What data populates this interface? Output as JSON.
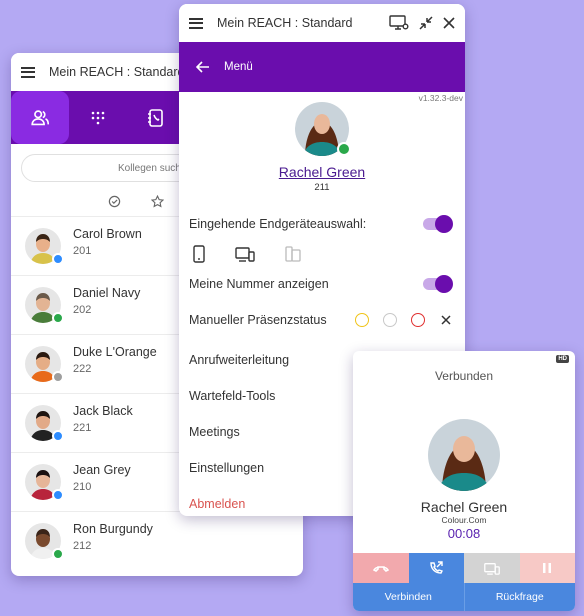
{
  "back_window": {
    "title": "Mein REACH : Standard",
    "search_placeholder": "Kollegen suche",
    "contacts": [
      {
        "name": "Carol Brown",
        "number": "201",
        "status_color": "#2d8cff",
        "skin": "#e8b08a",
        "hair": "#3a2516",
        "shirt": "#d8c24a"
      },
      {
        "name": "Daniel Navy",
        "number": "202",
        "status_color": "#2aa84a",
        "skin": "#e3b494",
        "hair": "#6b5a4a",
        "shirt": "#4a7d3a"
      },
      {
        "name": "Duke L'Orange",
        "number": "222",
        "status_color": "#9e9e9e",
        "skin": "#e5ad86",
        "hair": "#2b1a10",
        "shirt": "#e86a1a"
      },
      {
        "name": "Jack Black",
        "number": "221",
        "status_color": "#2d8cff",
        "skin": "#e2aa88",
        "hair": "#1e1410",
        "shirt": "#222222"
      },
      {
        "name": "Jean Grey",
        "number": "210",
        "status_color": "#2d8cff",
        "skin": "#e6b598",
        "hair": "#1a1010",
        "shirt": "#b8243c"
      },
      {
        "name": "Ron Burgundy",
        "number": "212",
        "status_color": "#2aa84a",
        "skin": "#7a4a2e",
        "hair": "#3a2418",
        "shirt": "#f0f0f0"
      }
    ]
  },
  "main_window": {
    "title": "Mein REACH : Standard",
    "header_label": "Menü",
    "version": "v1.32.3-dev",
    "profile": {
      "name": "Rachel Green",
      "extension": "211",
      "status_color": "#2aa84a"
    },
    "incoming_device_label": "Eingehende Endgeräteauswahl:",
    "show_number_label": "Meine Nummer anzeigen",
    "presence_label": "Manueller Präsenzstatus",
    "presence_colors": [
      "#f0c419",
      "#c8c8c8",
      "#e03030"
    ],
    "menu_items": [
      "Anrufweiterleitung",
      "Wartefeld-Tools",
      "Meetings",
      "Einstellungen"
    ],
    "logout_label": "Abmelden",
    "logout_color": "#d9534f"
  },
  "call_window": {
    "hd_badge": "HD",
    "status": "Verbunden",
    "name": "Rachel Green",
    "company": "Colour.Com",
    "timer": "00:08",
    "connect_label": "Verbinden",
    "consult_label": "Rückfrage"
  },
  "colors": {
    "purple": "#6a0dad",
    "accent_blue": "#4a87de"
  }
}
